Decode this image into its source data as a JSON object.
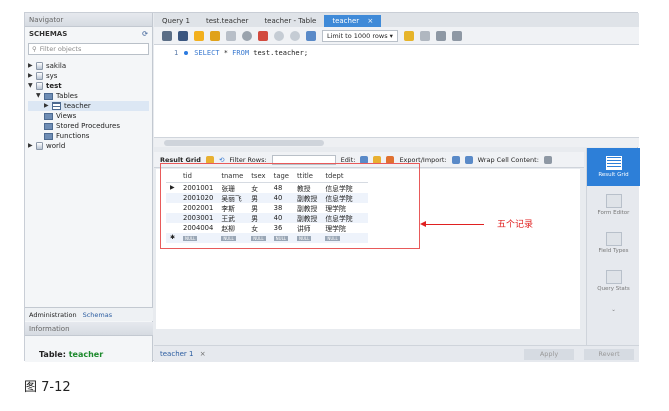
{
  "navigator": {
    "title": "Navigator",
    "schemas_label": "SCHEMAS",
    "filter_placeholder": "Filter objects",
    "tree": [
      "sakila",
      "sys",
      "test",
      "Tables",
      "teacher",
      "Views",
      "Stored Procedures",
      "Functions",
      "world"
    ],
    "tabs": [
      "Administration",
      "Schemas"
    ],
    "info_title": "Information",
    "table_label": "Table:",
    "table_name": "teacher"
  },
  "editor": {
    "tabs": [
      "Query 1",
      "test.teacher",
      "teacher - Table",
      "teacher"
    ],
    "limit_label": "Limit to 1000 rows",
    "line_no": "1",
    "sql_kw1": "SELECT",
    "sql_star": "*",
    "sql_kw2": "FROM",
    "sql_rest": "test.teacher;"
  },
  "result_toolbar": {
    "grid_label": "Result Grid",
    "filter_label": "Filter Rows:",
    "edit_label": "Edit:",
    "export_label": "Export/Import:",
    "wrap_label": "Wrap Cell Content:"
  },
  "result": {
    "columns": [
      "tid",
      "tname",
      "tsex",
      "tage",
      "ttitle",
      "tdept"
    ],
    "rows": [
      [
        "2001001",
        "张珊",
        "女",
        "48",
        "教授",
        "信息学院"
      ],
      [
        "2001020",
        "吴丽飞",
        "男",
        "40",
        "副教授",
        "信息学院"
      ],
      [
        "2002001",
        "李斯",
        "男",
        "38",
        "副教授",
        "理学院"
      ],
      [
        "2003001",
        "王武",
        "男",
        "40",
        "副教授",
        "信息学院"
      ],
      [
        "2004004",
        "赵柳",
        "女",
        "36",
        "讲师",
        "理学院"
      ]
    ],
    "null_label": "NULL"
  },
  "annotation": "五个记录",
  "right_sidebar": [
    "Result Grid",
    "Form Editor",
    "Field Types",
    "Query Stats"
  ],
  "bottom": {
    "tab": "teacher 1",
    "apply": "Apply",
    "revert": "Revert"
  },
  "caption": "图 7-12"
}
